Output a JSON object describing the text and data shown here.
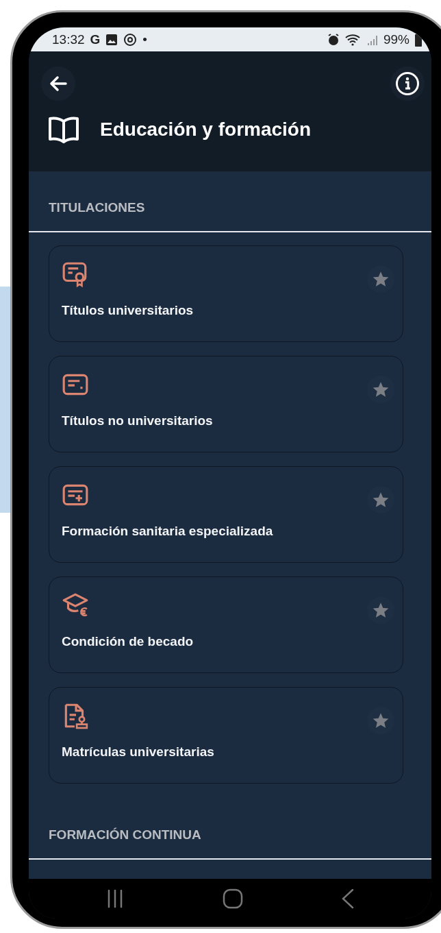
{
  "status_bar": {
    "time": "13:32",
    "letter": "G",
    "dot": "•",
    "battery": "99%"
  },
  "header": {
    "title": "Educación y formación"
  },
  "sections": [
    {
      "title": "TITULACIONES",
      "items": [
        {
          "label": "Títulos universitarios",
          "favorite": false
        },
        {
          "label": "Títulos no universitarios",
          "favorite": false
        },
        {
          "label": "Formación sanitaria especializada",
          "favorite": false
        },
        {
          "label": "Condición de becado",
          "favorite": false
        },
        {
          "label": "Matrículas universitarias",
          "favorite": false
        }
      ]
    },
    {
      "title": "FORMACIÓN CONTINUA"
    }
  ]
}
